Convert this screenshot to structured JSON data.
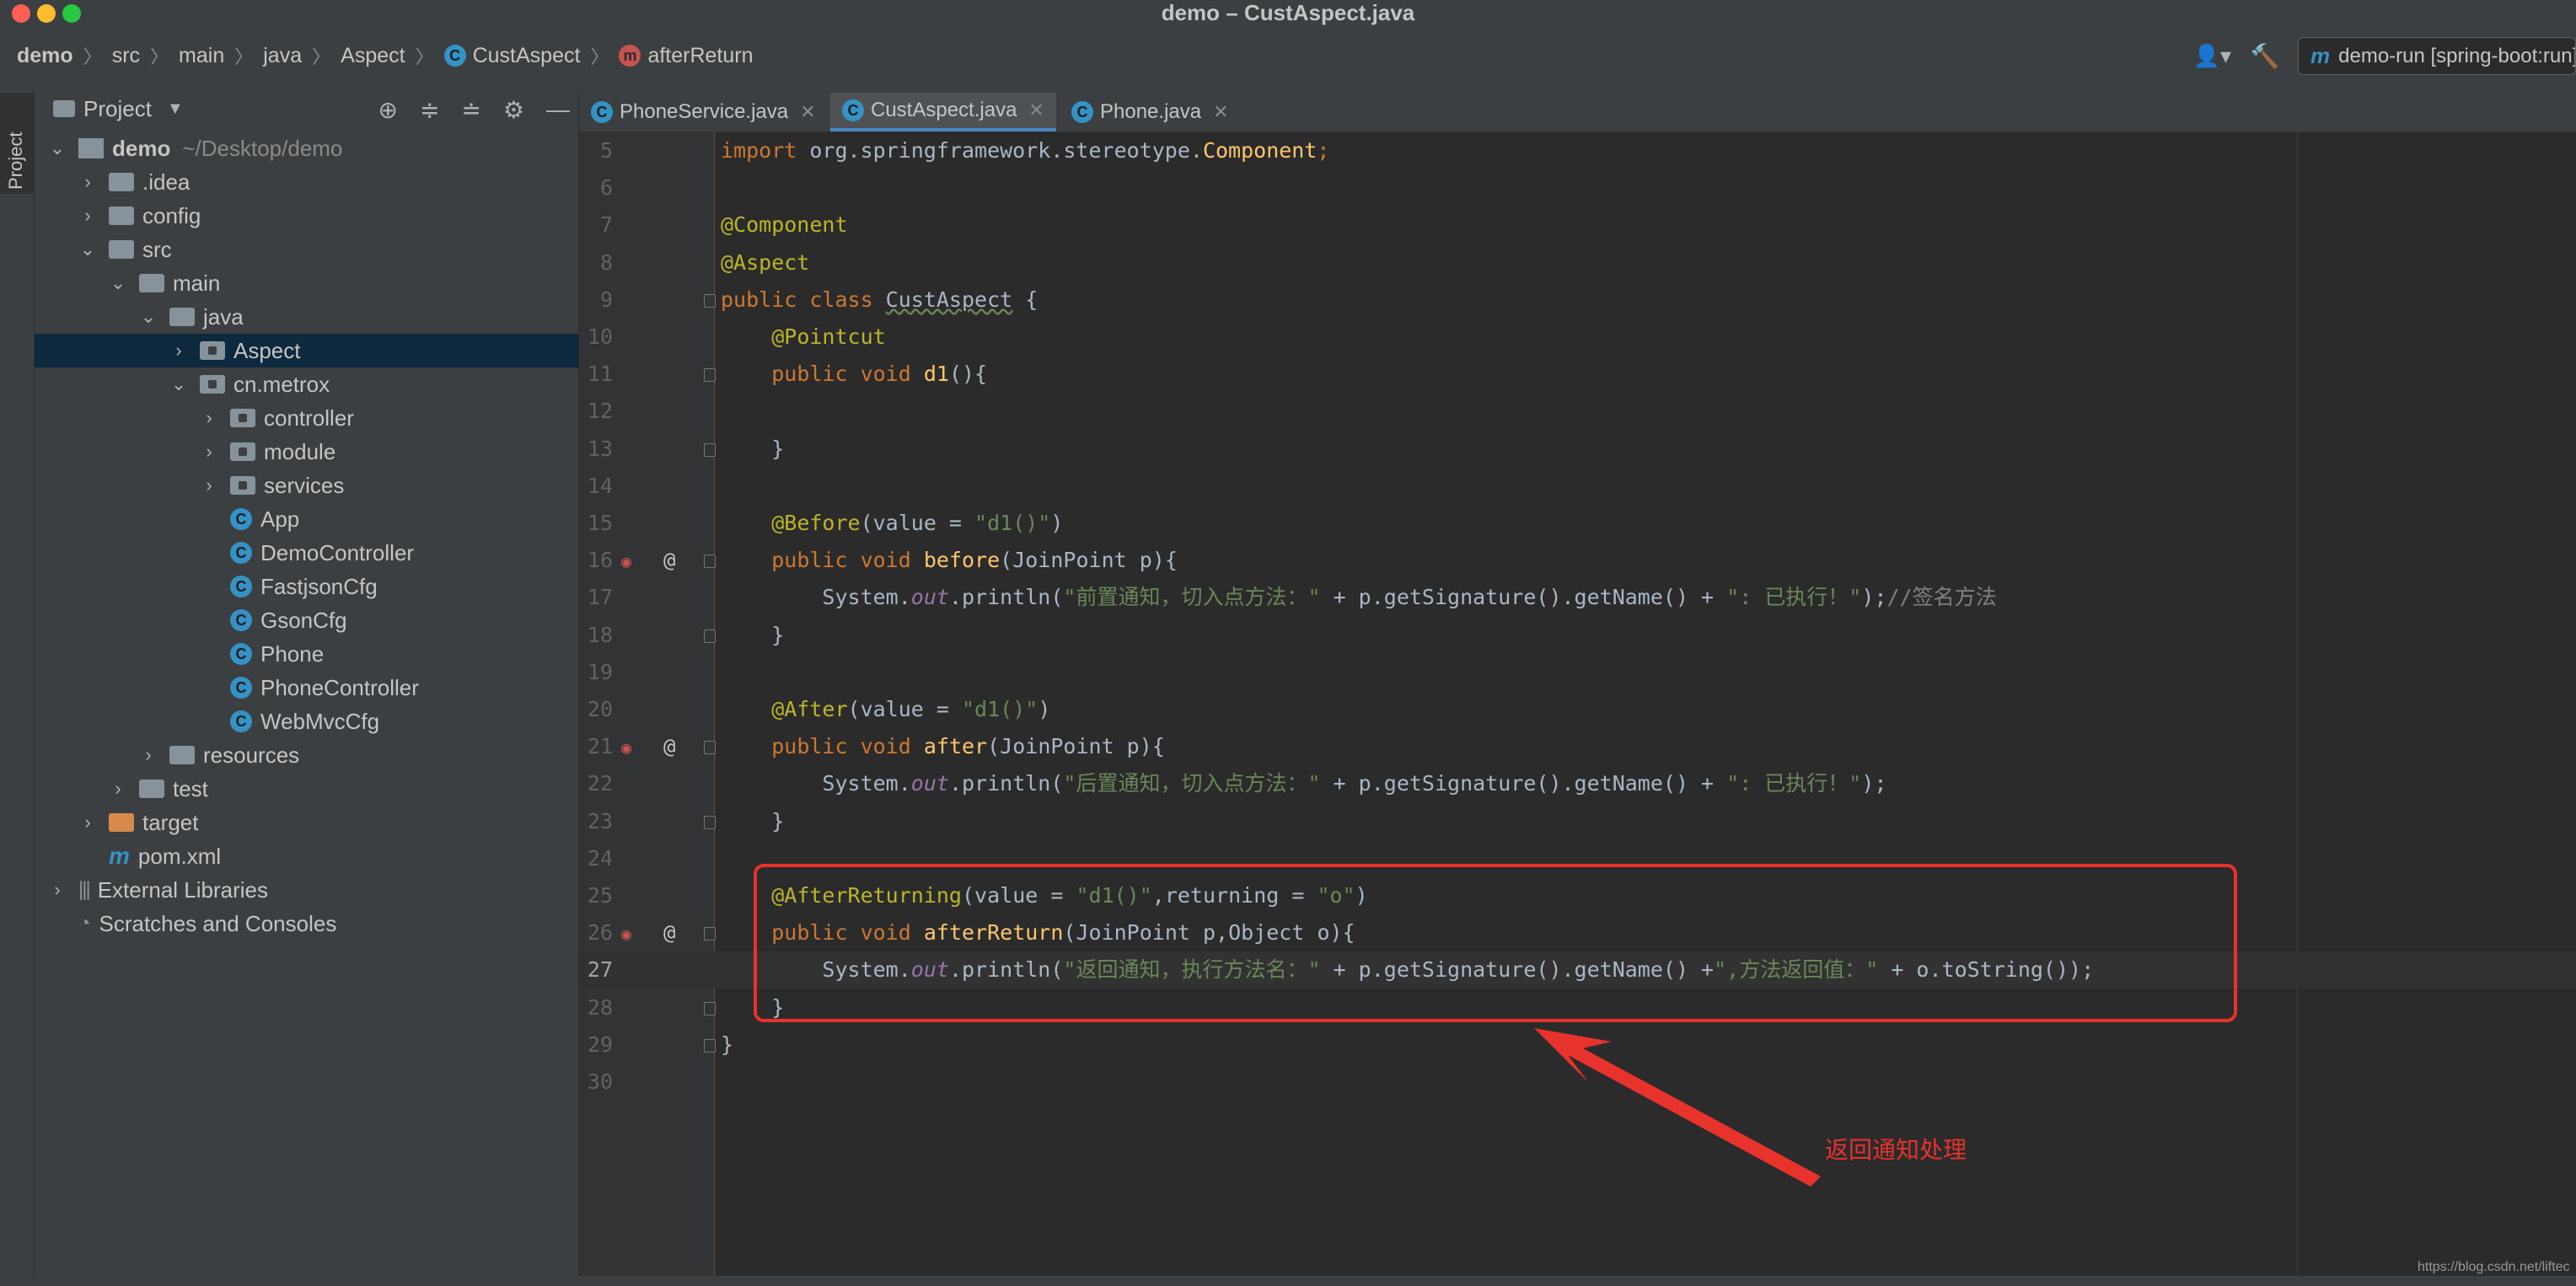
{
  "window": {
    "title": "demo – CustAspect.java"
  },
  "breadcrumb": {
    "items": [
      {
        "label": "demo",
        "icon": ""
      },
      {
        "label": "src",
        "icon": ""
      },
      {
        "label": "main",
        "icon": ""
      },
      {
        "label": "java",
        "icon": ""
      },
      {
        "label": "Aspect",
        "icon": ""
      },
      {
        "label": "CustAspect",
        "icon": "class-icon"
      },
      {
        "label": "afterReturn",
        "icon": "method-icon"
      }
    ]
  },
  "toolbar": {
    "run_config": "demo-run [spring-boot:run]"
  },
  "side_strip": {
    "project_label": "Project"
  },
  "project_panel": {
    "title": "Project",
    "tree": [
      {
        "label": "demo",
        "extra": "~/Desktop/demo",
        "depth": 0,
        "arrow": "v",
        "icon": "module"
      },
      {
        "label": ".idea",
        "depth": 1,
        "arrow": ">",
        "icon": "folder"
      },
      {
        "label": "config",
        "depth": 1,
        "arrow": ">",
        "icon": "folder"
      },
      {
        "label": "src",
        "depth": 1,
        "arrow": "v",
        "icon": "folder"
      },
      {
        "label": "main",
        "depth": 2,
        "arrow": "v",
        "icon": "folder"
      },
      {
        "label": "java",
        "depth": 3,
        "arrow": "v",
        "icon": "folder"
      },
      {
        "label": "Aspect",
        "depth": 4,
        "arrow": ">",
        "icon": "package",
        "selected": true
      },
      {
        "label": "cn.metrox",
        "depth": 4,
        "arrow": "v",
        "icon": "package"
      },
      {
        "label": "controller",
        "depth": 5,
        "arrow": ">",
        "icon": "package"
      },
      {
        "label": "module",
        "depth": 5,
        "arrow": ">",
        "icon": "package"
      },
      {
        "label": "services",
        "depth": 5,
        "arrow": ">",
        "icon": "package"
      },
      {
        "label": "App",
        "depth": 5,
        "arrow": "",
        "icon": "class"
      },
      {
        "label": "DemoController",
        "depth": 5,
        "arrow": "",
        "icon": "class"
      },
      {
        "label": "FastjsonCfg",
        "depth": 5,
        "arrow": "",
        "icon": "class"
      },
      {
        "label": "GsonCfg",
        "depth": 5,
        "arrow": "",
        "icon": "class"
      },
      {
        "label": "Phone",
        "depth": 5,
        "arrow": "",
        "icon": "class"
      },
      {
        "label": "PhoneController",
        "depth": 5,
        "arrow": "",
        "icon": "class"
      },
      {
        "label": "WebMvcCfg",
        "depth": 5,
        "arrow": "",
        "icon": "class"
      },
      {
        "label": "resources",
        "depth": 3,
        "arrow": ">",
        "icon": "folder"
      },
      {
        "label": "test",
        "depth": 2,
        "arrow": ">",
        "icon": "folder"
      },
      {
        "label": "target",
        "depth": 1,
        "arrow": ">",
        "icon": "folder-orange"
      },
      {
        "label": "pom.xml",
        "depth": 1,
        "arrow": "",
        "icon": "maven"
      },
      {
        "label": "External Libraries",
        "depth": 0,
        "arrow": ">",
        "icon": "libraries"
      },
      {
        "label": "Scratches and Consoles",
        "depth": 0,
        "arrow": "",
        "icon": "scratches"
      }
    ]
  },
  "tabs": [
    {
      "label": "PhoneService.java",
      "active": false
    },
    {
      "label": "CustAspect.java",
      "active": true
    },
    {
      "label": "Phone.java",
      "active": false
    }
  ],
  "editor": {
    "current_line": 27,
    "lines": [
      {
        "n": "5",
        "tokens": [
          [
            "kw",
            "import "
          ],
          [
            "",
            "org.springframework.stereotype."
          ],
          [
            "fn",
            "Component"
          ],
          [
            "kw",
            ";"
          ]
        ]
      },
      {
        "n": "6",
        "tokens": []
      },
      {
        "n": "7",
        "tokens": [
          [
            "an",
            "@Component"
          ]
        ]
      },
      {
        "n": "8",
        "tokens": [
          [
            "an",
            "@Aspect"
          ]
        ]
      },
      {
        "n": "9",
        "tokens": [
          [
            "kw",
            "public class "
          ],
          [
            "ul",
            "CustAspect"
          ],
          [
            "",
            " {"
          ]
        ]
      },
      {
        "n": "10",
        "tokens": [
          [
            "",
            "    "
          ],
          [
            "an",
            "@Pointcut"
          ]
        ]
      },
      {
        "n": "11",
        "tokens": [
          [
            "",
            "    "
          ],
          [
            "kw",
            "public void "
          ],
          [
            "fn",
            "d1"
          ],
          [
            "",
            "(){"
          ]
        ]
      },
      {
        "n": "12",
        "tokens": []
      },
      {
        "n": "13",
        "tokens": [
          [
            "",
            "    }"
          ]
        ]
      },
      {
        "n": "14",
        "tokens": []
      },
      {
        "n": "15",
        "tokens": [
          [
            "",
            "    "
          ],
          [
            "an",
            "@Before"
          ],
          [
            "",
            "(value = "
          ],
          [
            "st",
            "\"d1()\""
          ],
          [
            "",
            ")"
          ]
        ]
      },
      {
        "n": "16",
        "tokens": [
          [
            "",
            "    "
          ],
          [
            "kw",
            "public void "
          ],
          [
            "fn",
            "before"
          ],
          [
            "",
            "(JoinPoint p){"
          ]
        ]
      },
      {
        "n": "17",
        "tokens": [
          [
            "",
            "        System."
          ],
          [
            "it",
            "out"
          ],
          [
            "",
            ".println("
          ],
          [
            "st",
            "\"前置通知，切入点方法：\""
          ],
          [
            "",
            " + p.getSignature().getName() + "
          ],
          [
            "st",
            "\": 已执行！\""
          ],
          [
            "",
            ");"
          ],
          [
            "cm",
            "//签名方法"
          ]
        ]
      },
      {
        "n": "18",
        "tokens": [
          [
            "",
            "    }"
          ]
        ]
      },
      {
        "n": "19",
        "tokens": []
      },
      {
        "n": "20",
        "tokens": [
          [
            "",
            "    "
          ],
          [
            "an",
            "@After"
          ],
          [
            "",
            "(value = "
          ],
          [
            "st",
            "\"d1()\""
          ],
          [
            "",
            ")"
          ]
        ]
      },
      {
        "n": "21",
        "tokens": [
          [
            "",
            "    "
          ],
          [
            "kw",
            "public void "
          ],
          [
            "fn",
            "after"
          ],
          [
            "",
            "(JoinPoint p){"
          ]
        ]
      },
      {
        "n": "22",
        "tokens": [
          [
            "",
            "        System."
          ],
          [
            "it",
            "out"
          ],
          [
            "",
            ".println("
          ],
          [
            "st",
            "\"后置通知，切入点方法：\""
          ],
          [
            "",
            " + p.getSignature().getName() + "
          ],
          [
            "st",
            "\": 已执行！\""
          ],
          [
            "",
            ");"
          ]
        ]
      },
      {
        "n": "23",
        "tokens": [
          [
            "",
            "    }"
          ]
        ]
      },
      {
        "n": "24",
        "tokens": []
      },
      {
        "n": "25",
        "tokens": [
          [
            "",
            "    "
          ],
          [
            "an",
            "@AfterReturning"
          ],
          [
            "",
            "(value = "
          ],
          [
            "st",
            "\"d1()\""
          ],
          [
            "",
            ",returning = "
          ],
          [
            "st",
            "\"o\""
          ],
          [
            "",
            ")"
          ]
        ]
      },
      {
        "n": "26",
        "tokens": [
          [
            "",
            "    "
          ],
          [
            "kw",
            "public void "
          ],
          [
            "fn",
            "afterReturn"
          ],
          [
            "",
            "(JoinPoint p,Object o){"
          ]
        ]
      },
      {
        "n": "27",
        "tokens": [
          [
            "",
            "        System."
          ],
          [
            "it",
            "out"
          ],
          [
            "",
            ".println("
          ],
          [
            "st",
            "\"返回通知，执行方法名：\""
          ],
          [
            "",
            " + p.getSignature().getName() +"
          ],
          [
            "st",
            "\",方法返回值：\""
          ],
          [
            "",
            " + o.toString());"
          ]
        ]
      },
      {
        "n": "28",
        "tokens": [
          [
            "",
            "    }"
          ]
        ]
      },
      {
        "n": "29",
        "tokens": [
          [
            "",
            "}"
          ]
        ]
      },
      {
        "n": "30",
        "tokens": []
      }
    ]
  },
  "annotation": {
    "note": "返回通知处理",
    "color": "#e8322c"
  },
  "watermark": "https://blog.csdn.net/liftec"
}
